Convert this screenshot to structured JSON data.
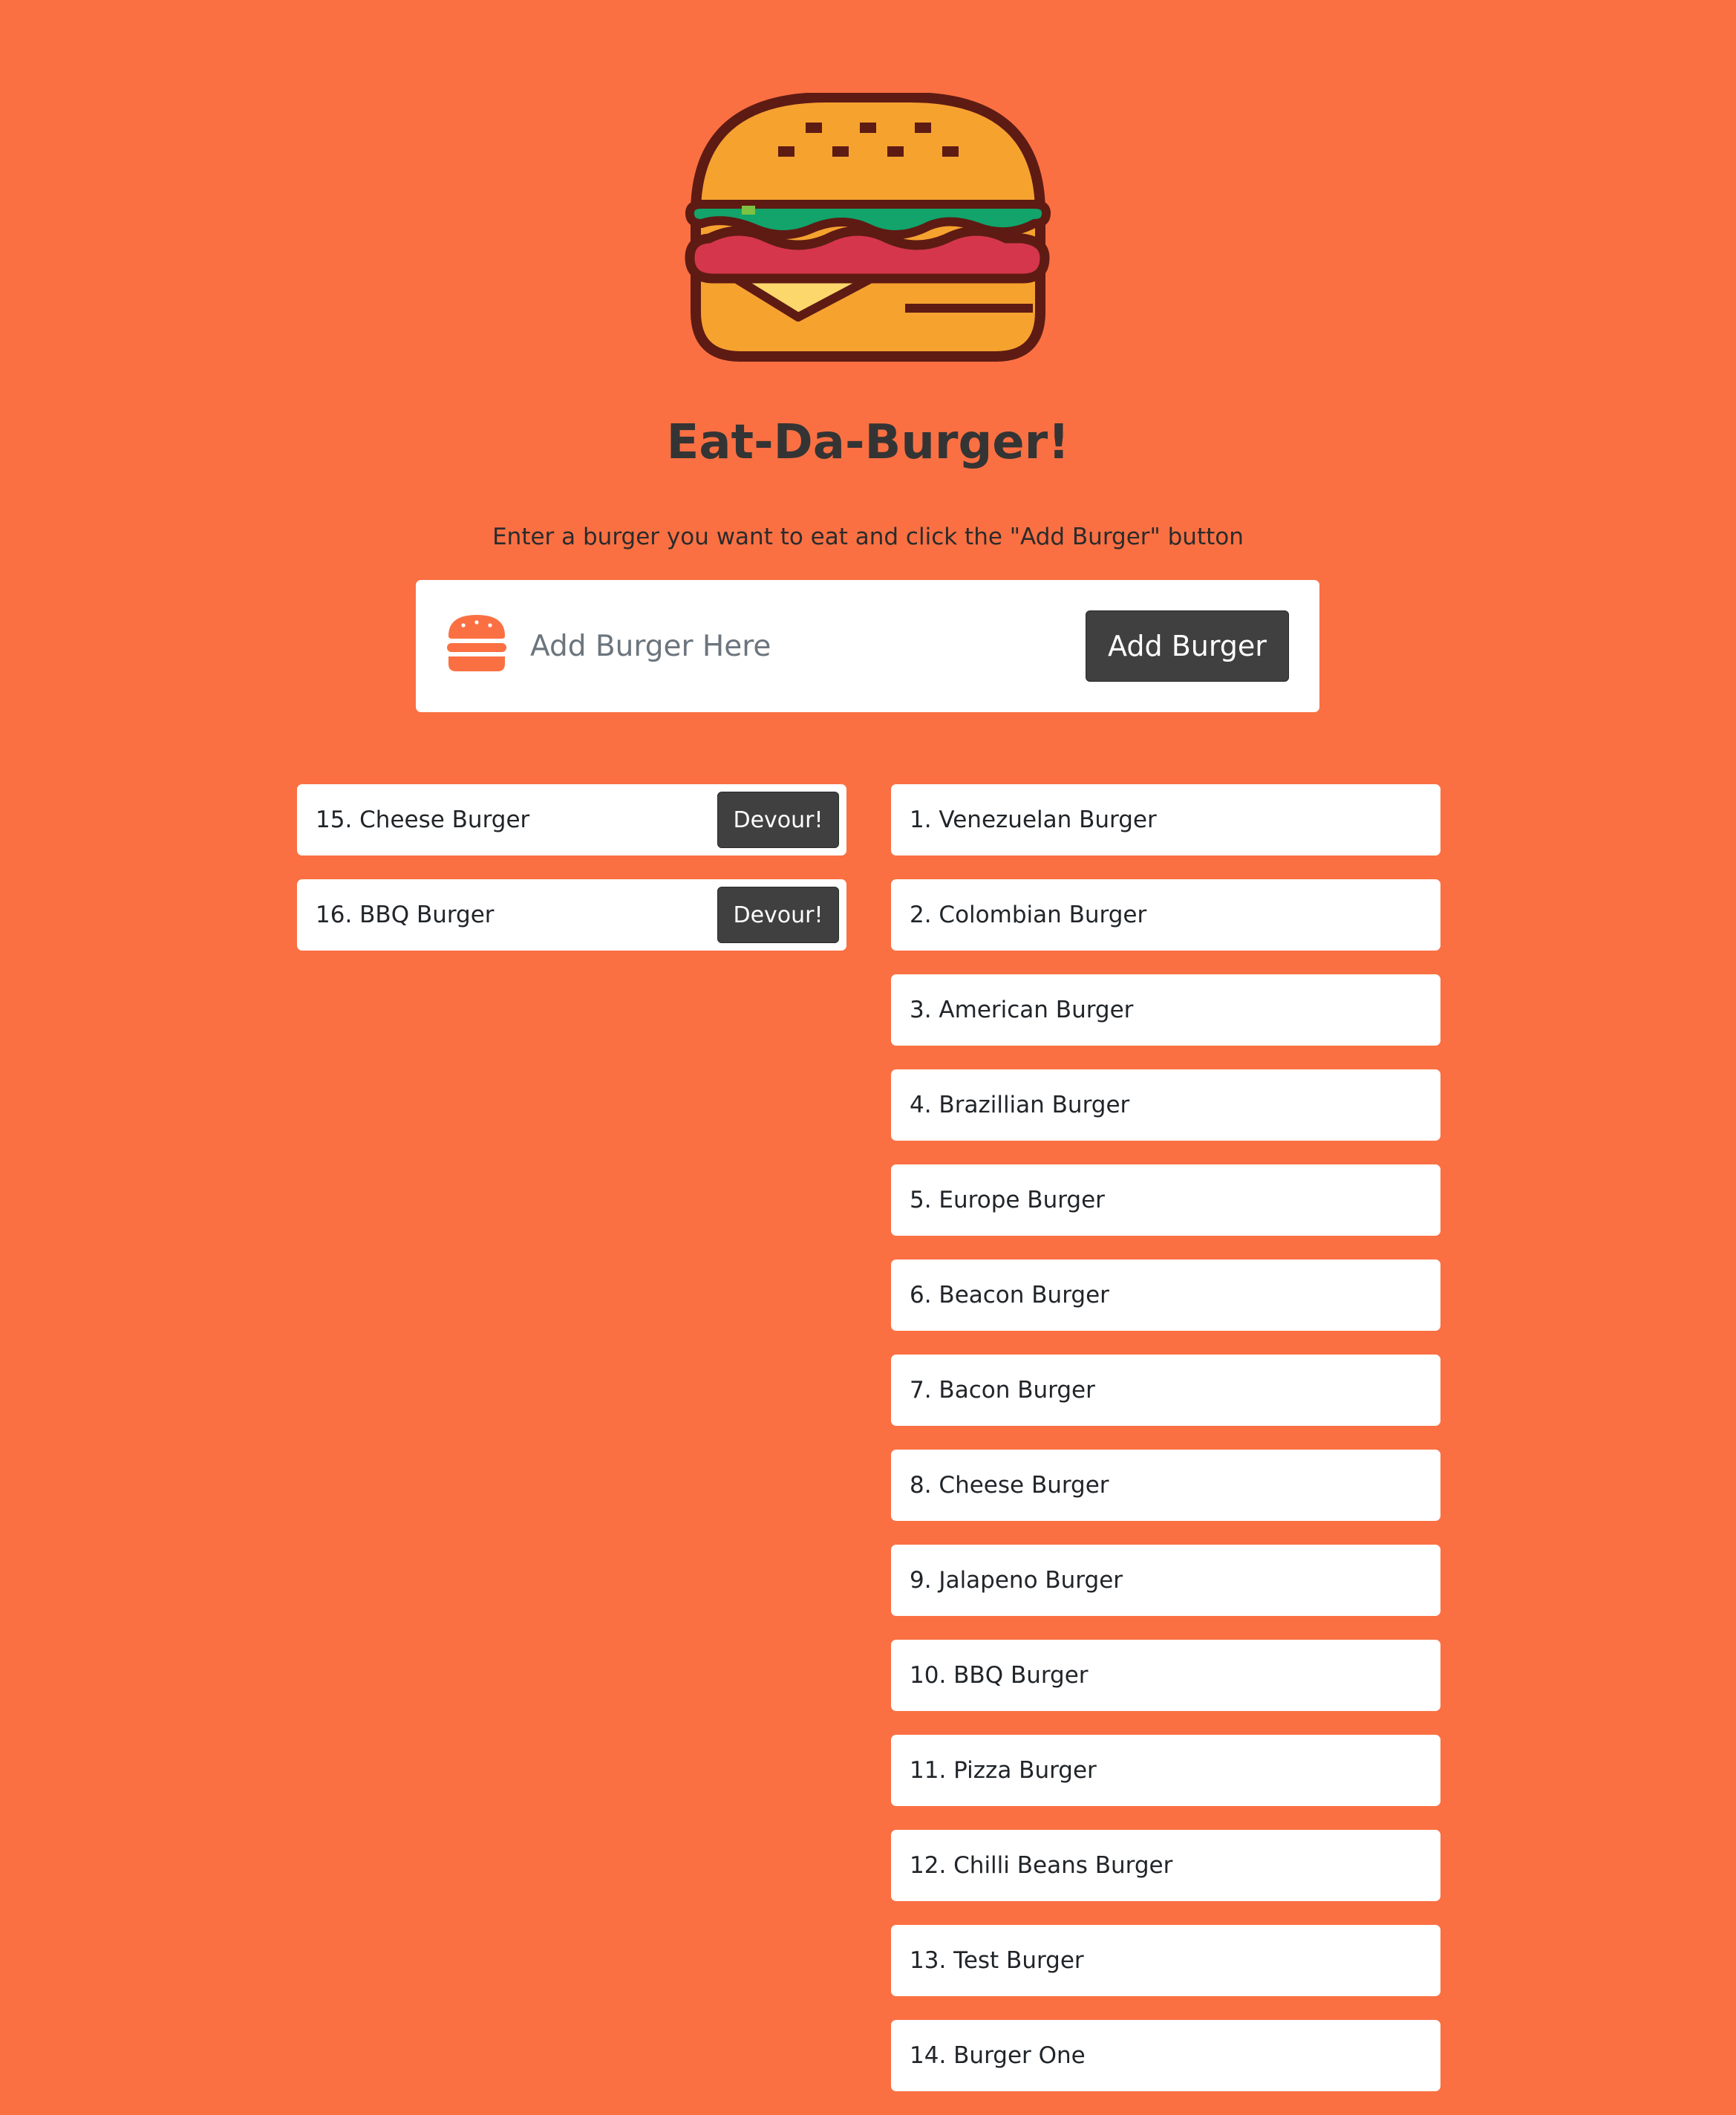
{
  "header": {
    "logo_icon": "burger-icon",
    "title": "Eat-Da-Burger!",
    "instructions": "Enter a burger you want to eat and click the \"Add Burger\" button"
  },
  "add_form": {
    "input_icon": "burger-icon",
    "input_value": "",
    "input_placeholder": "Add Burger Here",
    "button_label": "Add Burger"
  },
  "colors": {
    "background": "#FA7043",
    "button_bg": "#404040",
    "card_bg": "#FFFFFF"
  },
  "to_devour": [
    {
      "label": "15. Cheese Burger",
      "button_label": "Devour!"
    },
    {
      "label": "16. BBQ Burger",
      "button_label": "Devour!"
    }
  ],
  "devoured": [
    {
      "label": "1. Venezuelan Burger"
    },
    {
      "label": "2. Colombian Burger"
    },
    {
      "label": "3. American Burger"
    },
    {
      "label": "4. Brazillian Burger"
    },
    {
      "label": "5. Europe Burger"
    },
    {
      "label": "6. Beacon Burger"
    },
    {
      "label": "7. Bacon Burger"
    },
    {
      "label": "8. Cheese Burger"
    },
    {
      "label": "9. Jalapeno Burger"
    },
    {
      "label": "10. BBQ Burger"
    },
    {
      "label": "11. Pizza Burger"
    },
    {
      "label": "12. Chilli Beans Burger"
    },
    {
      "label": "13. Test Burger"
    },
    {
      "label": "14. Burger One"
    }
  ]
}
